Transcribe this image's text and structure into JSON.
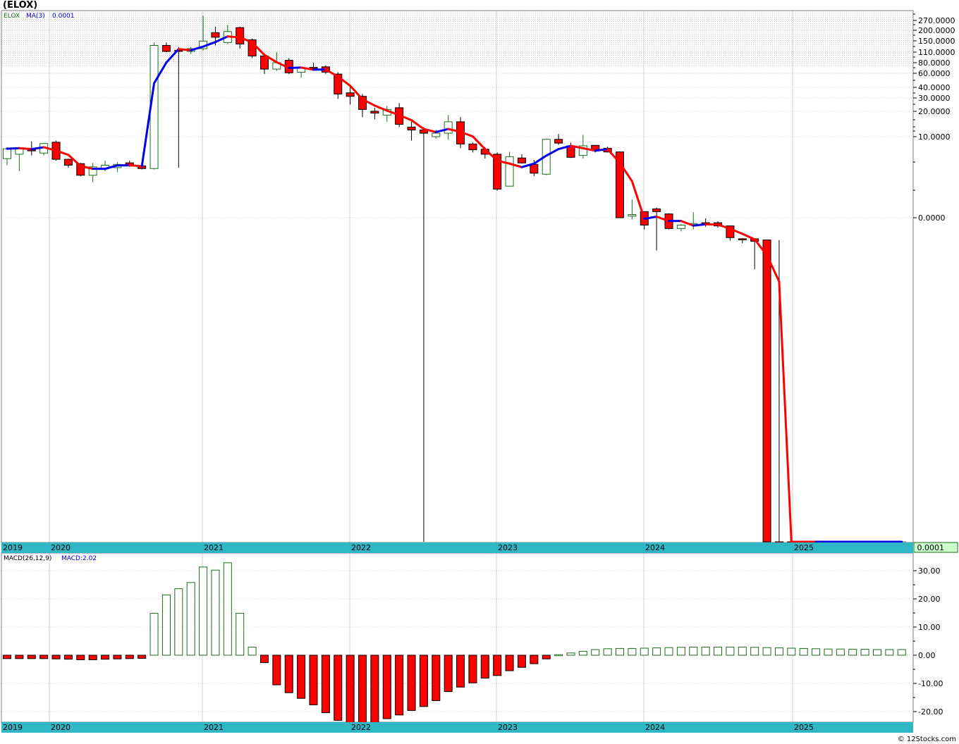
{
  "title": "(ELOX)",
  "credit": "© 12Stocks.com",
  "colors": {
    "up": "#1a6e1a",
    "down": "#ff0000",
    "ma_up": "#0000ee",
    "ma_down": "#ff0000",
    "axis_band": "#2fb7c6",
    "last_box": "#ccffcc"
  },
  "price_panel": {
    "legend_symbol": "ELOX",
    "legend_ma": "MA(3)",
    "legend_value": "0.0001",
    "last_value": "0.0001",
    "scale": "log",
    "y_ticks": [
      "270.0000",
      "200.0000",
      "150.0000",
      "110.0000",
      "80.0000",
      "60.0000",
      "40.0000",
      "30.0000",
      "20.0000",
      "10.0000",
      "0.0000"
    ]
  },
  "macd_panel": {
    "legend_name": "MACD(26,12,9)",
    "legend_value": "MACD:2.02",
    "y_ticks": [
      "30.00",
      "20.00",
      "10.00",
      "0.00",
      "-10.00",
      "-20.00"
    ]
  },
  "x_axis": {
    "year_labels": [
      "2019",
      "2020",
      "2021",
      "2022",
      "2023",
      "2024",
      "2025"
    ]
  },
  "chart_data": [
    {
      "type": "candlestick",
      "title": "(ELOX)",
      "interval": "monthly",
      "scale": "log",
      "series_name": "ELOX",
      "ma_name": "MA(3)",
      "columns": [
        "open",
        "high",
        "low",
        "close"
      ],
      "candles": [
        [
          5.5,
          7.5,
          4.6,
          7.2
        ],
        [
          6.2,
          7.6,
          3.9,
          7.4
        ],
        [
          7.0,
          8.8,
          6.0,
          6.8
        ],
        [
          6.4,
          8.5,
          6.0,
          8.3
        ],
        [
          8.6,
          9.0,
          5.2,
          5.4
        ],
        [
          5.4,
          5.5,
          4.3,
          4.6
        ],
        [
          4.8,
          4.9,
          3.4,
          3.5
        ],
        [
          3.5,
          4.9,
          2.9,
          4.4
        ],
        [
          4.2,
          5.2,
          3.9,
          4.6
        ],
        [
          4.3,
          5.0,
          3.8,
          4.7
        ],
        [
          4.9,
          5.2,
          4.4,
          4.5
        ],
        [
          4.5,
          4.7,
          4.1,
          4.2
        ],
        [
          4.2,
          130,
          4.1,
          120
        ],
        [
          120,
          130,
          100,
          102
        ],
        [
          105,
          115,
          4.3,
          104
        ],
        [
          102,
          115,
          95,
          110
        ],
        [
          110,
          270,
          105,
          135
        ],
        [
          170,
          200,
          120,
          150
        ],
        [
          130,
          210,
          125,
          175
        ],
        [
          195,
          200,
          110,
          125
        ],
        [
          140,
          145,
          85,
          90
        ],
        [
          90,
          95,
          55,
          63
        ],
        [
          63,
          100,
          60,
          75
        ],
        [
          80,
          85,
          55,
          57
        ],
        [
          58,
          65,
          50,
          65
        ],
        [
          66,
          75,
          60,
          64
        ],
        [
          67,
          70,
          55,
          58
        ],
        [
          55,
          58,
          28,
          32
        ],
        [
          33,
          40,
          24,
          30
        ],
        [
          30,
          32,
          17,
          21
        ],
        [
          20,
          22,
          16,
          19
        ],
        [
          18,
          23,
          15,
          21
        ],
        [
          22,
          25,
          13,
          14
        ],
        [
          13,
          15,
          9.0,
          12
        ],
        [
          12,
          13,
          8e-07,
          11
        ],
        [
          10,
          12,
          9.5,
          11
        ],
        [
          11,
          18,
          9.2,
          15
        ],
        [
          15,
          17,
          7.3,
          8.2
        ],
        [
          8.2,
          8.5,
          6.5,
          7.0
        ],
        [
          7.1,
          7.5,
          5.5,
          6.2
        ],
        [
          6.2,
          6.5,
          2.3,
          2.4
        ],
        [
          2.6,
          6.6,
          2.6,
          5.8
        ],
        [
          5.6,
          6.2,
          4.8,
          4.9
        ],
        [
          4.7,
          5.3,
          3.4,
          3.7
        ],
        [
          3.6,
          9.5,
          3.5,
          9.3
        ],
        [
          9.3,
          10.8,
          8.0,
          8.4
        ],
        [
          7.8,
          8.5,
          5.6,
          5.7
        ],
        [
          6.0,
          10.5,
          5.5,
          7.8
        ],
        [
          7.9,
          8.0,
          6.5,
          7.0
        ],
        [
          7.3,
          7.6,
          6.5,
          6.6
        ],
        [
          6.6,
          6.7,
          1.1,
          1.1
        ],
        [
          1.15,
          1.8,
          1.05,
          1.2
        ],
        [
          1.3,
          1.3,
          0.8,
          0.9
        ],
        [
          1.4,
          1.45,
          0.45,
          1.3
        ],
        [
          1.22,
          1.24,
          0.8,
          0.82
        ],
        [
          0.82,
          0.93,
          0.76,
          0.9
        ],
        [
          0.92,
          1.28,
          0.8,
          0.94
        ],
        [
          0.96,
          1.08,
          0.86,
          0.92
        ],
        [
          0.96,
          1.0,
          0.84,
          0.88
        ],
        [
          0.88,
          0.89,
          0.59,
          0.64
        ],
        [
          0.62,
          0.63,
          0.55,
          0.61
        ],
        [
          0.62,
          0.63,
          0.27,
          0.58
        ],
        [
          0.6,
          0.6,
          2e-07,
          9.7e-06
        ],
        [
          2.8e-06,
          0.6,
          2e-07,
          6e-07
        ],
        [
          2.7e-07,
          2.7e-06,
          1e-07,
          1e-07
        ],
        [
          1e-07,
          1e-07,
          1e-07,
          1e-07
        ],
        [
          1e-07,
          1e-07,
          1e-07,
          1e-07
        ],
        [
          1e-07,
          1e-07,
          1e-07,
          1e-07
        ],
        [
          1e-07,
          2.5e-05,
          1e-07,
          1e-07
        ],
        [
          1e-07,
          2.5e-05,
          1e-07,
          1e-07
        ],
        [
          1e-07,
          1e-07,
          1e-07,
          1e-07
        ],
        [
          1e-07,
          1e-07,
          1e-07,
          1e-07
        ],
        [
          1e-07,
          1e-07,
          1e-07,
          1e-07
        ],
        [
          1e-07,
          1e-07,
          1e-07,
          1e-07
        ]
      ]
    },
    {
      "type": "bar",
      "title": "MACD(26,12,9)",
      "last_label": "MACD:2.02",
      "ylim": [
        -24,
        34
      ],
      "values": [
        -1.2,
        -1.2,
        -1.2,
        -1.2,
        -1.3,
        -1.4,
        -1.6,
        -1.6,
        -1.4,
        -1.3,
        -1.2,
        -1.1,
        14.9,
        21.4,
        23.6,
        25.8,
        31.3,
        30.2,
        32.8,
        14.9,
        2.9,
        -2.6,
        -10.5,
        -13.3,
        -15.3,
        -17.6,
        -20.4,
        -23.1,
        -24.2,
        -24.7,
        -23.9,
        -22.5,
        -21.2,
        -19.6,
        -18.2,
        -16.1,
        -12.9,
        -11.3,
        -9.8,
        -8.1,
        -7.2,
        -5.5,
        -4.3,
        -3.0,
        -1.3,
        0.2,
        0.8,
        1.4,
        2.0,
        2.3,
        2.4,
        2.4,
        2.5,
        2.6,
        2.7,
        2.8,
        2.9,
        2.9,
        2.9,
        2.9,
        2.9,
        2.8,
        2.7,
        2.6,
        2.5,
        2.4,
        2.3,
        2.2,
        2.2,
        2.1,
        2.1,
        2.0,
        2.0,
        2.02
      ]
    }
  ]
}
